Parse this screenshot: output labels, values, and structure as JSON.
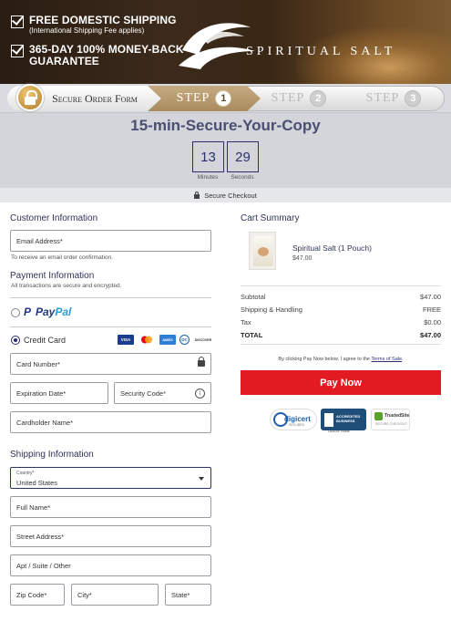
{
  "header": {
    "perk1_title": "FREE DOMESTIC SHIPPING",
    "perk1_sub": "(International Shipping Fee applies)",
    "perk2_line1": "365-DAY 100% MONEY-BACK",
    "perk2_line2": "GUARANTEE",
    "brand": "SPIRITUAL SALT"
  },
  "steps": {
    "secure": "Secure Order Form",
    "step_word": "STEP",
    "numbers": [
      "1",
      "2",
      "3"
    ]
  },
  "timer": {
    "title": "15-min-Secure-Your-Copy",
    "minutes": "13",
    "seconds": "29",
    "minutes_label": "Minutes",
    "seconds_label": "Seconds"
  },
  "secure_checkout": "Secure Checkout",
  "customer": {
    "title": "Customer Information",
    "email_label": "Email Address*",
    "email_hint": "To receive an email order confirmation."
  },
  "payment": {
    "title": "Payment Information",
    "subtitle": "All transactions are secure and encrypted.",
    "paypal_a": "Pay",
    "paypal_b": "Pal",
    "credit_card": "Credit Card",
    "cards": [
      "VISA",
      "MC",
      "AMEX",
      "DC",
      "DISCOVER"
    ],
    "card_number": "Card Number*",
    "expiration": "Expiration Date*",
    "security_code": "Security Code*",
    "cardholder": "Cardholder Name*"
  },
  "shipping": {
    "title": "Shipping Information",
    "country_label": "Country*",
    "country_value": "United States",
    "full_name": "Full Name*",
    "street": "Street Address*",
    "apt": "Apt / Suite / Other",
    "zip": "Zip Code*",
    "city": "City*",
    "state": "State*"
  },
  "cart": {
    "title": "Cart Summary",
    "product_name": "Spiritual Salt (1 Pouch)",
    "product_price": "$47.00",
    "rows": [
      {
        "label": "Subtotal",
        "value": "$47.00"
      },
      {
        "label": "Shipping & Handling",
        "value": "FREE"
      },
      {
        "label": "Tax",
        "value": "$0.00"
      },
      {
        "label": "TOTAL",
        "value": "$47.00"
      }
    ],
    "terms_prefix": "By clicking Pay Now below, I agree to the ",
    "terms_link": "Terms of Sale",
    "terms_suffix": ".",
    "pay_button": "Pay Now"
  },
  "badges": {
    "digicert": "digicert",
    "digicert_sub": "SECURED",
    "bbb_line1": "ACCREDITED",
    "bbb_line2": "BUSINESS",
    "bbb_sub": "Click for Profile",
    "trusted": "TrustedSite",
    "trusted_sub": "SECURE CHECKOUT"
  },
  "colors": {
    "accent": "#2b2f6b",
    "pay_button": "#e21b23",
    "step_active": "#a98b5d"
  }
}
